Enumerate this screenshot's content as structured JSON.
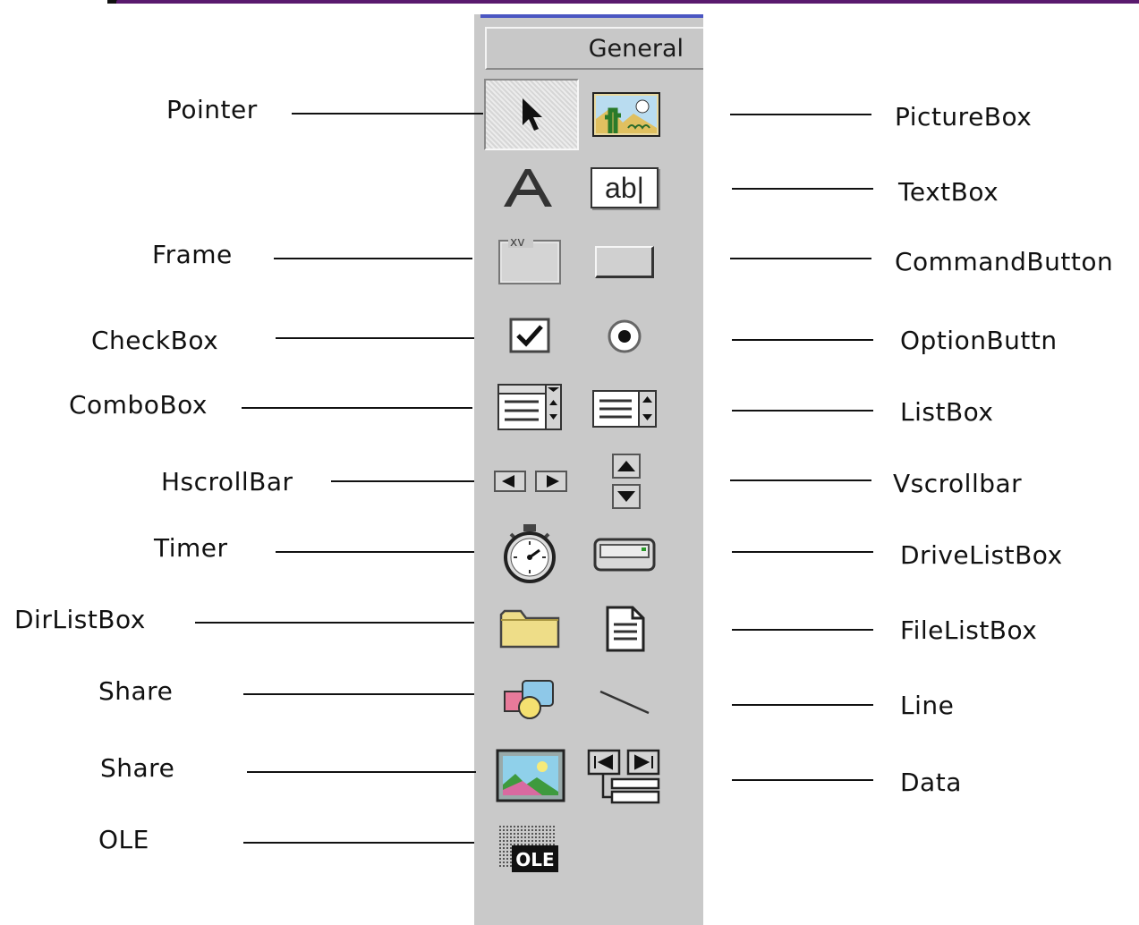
{
  "toolbox": {
    "tab_label": "General"
  },
  "labels": {
    "pointer": "Pointer",
    "picturebox": "PictureBox",
    "textbox": "TextBox",
    "frame": "Frame",
    "commandbutton": "CommandButton",
    "checkbox": "CheckBox",
    "optionbutton": "OptionButtn",
    "combobox": "ComboBox",
    "listbox": "ListBox",
    "hscrollbar": "HscrollBar",
    "vscrollbar": "Vscrollbar",
    "timer": "Timer",
    "drivelistbox": "DriveListBox",
    "dirlistbox": "DirListBox",
    "filelistbox": "FileListBox",
    "shape": "Share",
    "line": "Line",
    "image": "Share",
    "data": "Data",
    "ole": "OLE"
  },
  "icon_texts": {
    "textbox_glyph": "ab|",
    "frame_caption": "xv",
    "ole_badge": "OLE"
  },
  "icons": [
    "pointer-icon",
    "picturebox-icon",
    "label-icon",
    "textbox-icon",
    "frame-icon",
    "commandbutton-icon",
    "checkbox-icon",
    "optionbutton-icon",
    "combobox-icon",
    "listbox-icon",
    "hscrollbar-icon",
    "vscrollbar-icon",
    "timer-icon",
    "drivelistbox-icon",
    "dirlistbox-icon",
    "filelistbox-icon",
    "shape-icon",
    "line-icon",
    "image-icon",
    "data-icon",
    "ole-icon"
  ],
  "colors": {
    "toolbox_bg": "#c9c9c9",
    "title_accent": "#4a56c2",
    "top_rule": "#5a1a6e"
  }
}
